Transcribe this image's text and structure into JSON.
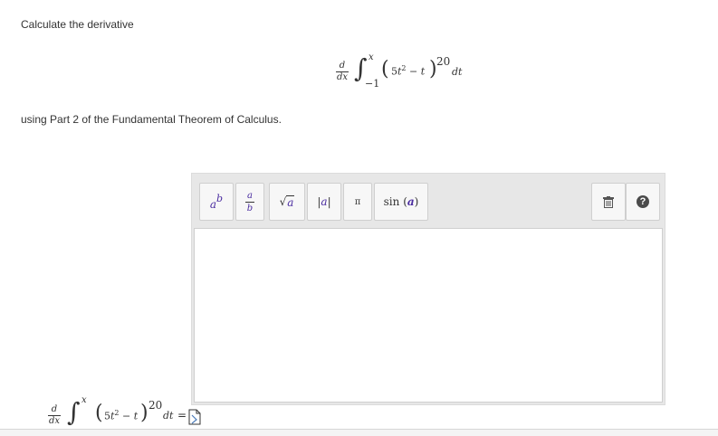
{
  "question": {
    "line1": "Calculate the derivative",
    "line2": "using Part 2 of the Fundamental Theorem of Calculus."
  },
  "expression": {
    "d": "d",
    "dx": "dx",
    "integral_sign": "∫",
    "upper_limit": "x",
    "lower_limit": "−1",
    "open_paren": "(",
    "close_paren": ")",
    "coef": "5",
    "var": "t",
    "sq": "2",
    "minus": "−",
    "exponent": "20",
    "dt": "dt"
  },
  "toolbar": {
    "power": {
      "base": "a",
      "exp": "b"
    },
    "fraction": {
      "num": "a",
      "den": "b"
    },
    "sqrt": {
      "sign": "√",
      "arg": "a"
    },
    "abs": {
      "left": "|",
      "arg": "a",
      "right": "|"
    },
    "pi": "π",
    "sin": {
      "fn": "sin",
      "open": "(",
      "arg": "a",
      "close": ")"
    },
    "trash_icon": "trash-icon",
    "help_glyph": "?"
  },
  "answer_row": {
    "equals": "="
  },
  "colors": {
    "variable": "#4a2ca0",
    "text": "#333333",
    "editor_bg": "#e7e7e7"
  }
}
